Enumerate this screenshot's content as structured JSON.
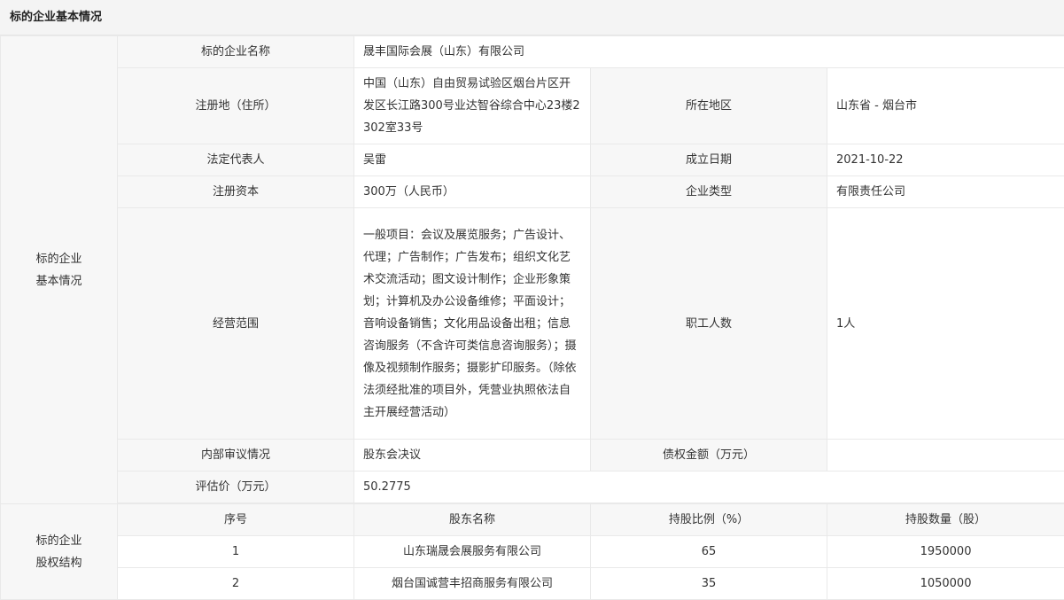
{
  "header": {
    "title": "标的企业基本情况"
  },
  "basic": {
    "section_label_1": "标的企业",
    "section_label_2": "基本情况",
    "company_name_label": "标的企业名称",
    "company_name": "晟丰国际会展（山东）有限公司",
    "address_label": "注册地（住所）",
    "address": "中国（山东）自由贸易试验区烟台片区开发区长江路300号业达智谷综合中心23楼2302室33号",
    "region_label": "所在地区",
    "region": "山东省 - 烟台市",
    "legal_rep_label": "法定代表人",
    "legal_rep": "吴雷",
    "founded_label": "成立日期",
    "founded": "2021-10-22",
    "capital_label": "注册资本",
    "capital": "300万（人民币）",
    "company_type_label": "企业类型",
    "company_type": "有限责任公司",
    "scope_label": "经营范围",
    "scope": "一般项目：会议及展览服务；广告设计、代理；广告制作；广告发布；组织文化艺术交流活动；图文设计制作；企业形象策划；计算机及办公设备维修；平面设计；音响设备销售；文化用品设备出租；信息咨询服务（不含许可类信息咨询服务）；摄像及视频制作服务；摄影扩印服务。（除依法须经批准的项目外，凭营业执照依法自主开展经营活动）",
    "employees_label": "职工人数",
    "employees": "1人",
    "audit_label": "内部审议情况",
    "audit": "股东会决议",
    "debt_label": "债权金额（万元）",
    "debt": "",
    "valuation_label": "评估价（万元）",
    "valuation": "50.2775"
  },
  "equity": {
    "section_label_1": "标的企业",
    "section_label_2": "股权结构",
    "columns": [
      "序号",
      "股东名称",
      "持股比例（%）",
      "持股数量（股）"
    ],
    "rows": [
      [
        "1",
        "山东瑞晟会展服务有限公司",
        "65",
        "1950000"
      ],
      [
        "2",
        "烟台国诚营丰招商服务有限公司",
        "35",
        "1050000"
      ]
    ]
  }
}
